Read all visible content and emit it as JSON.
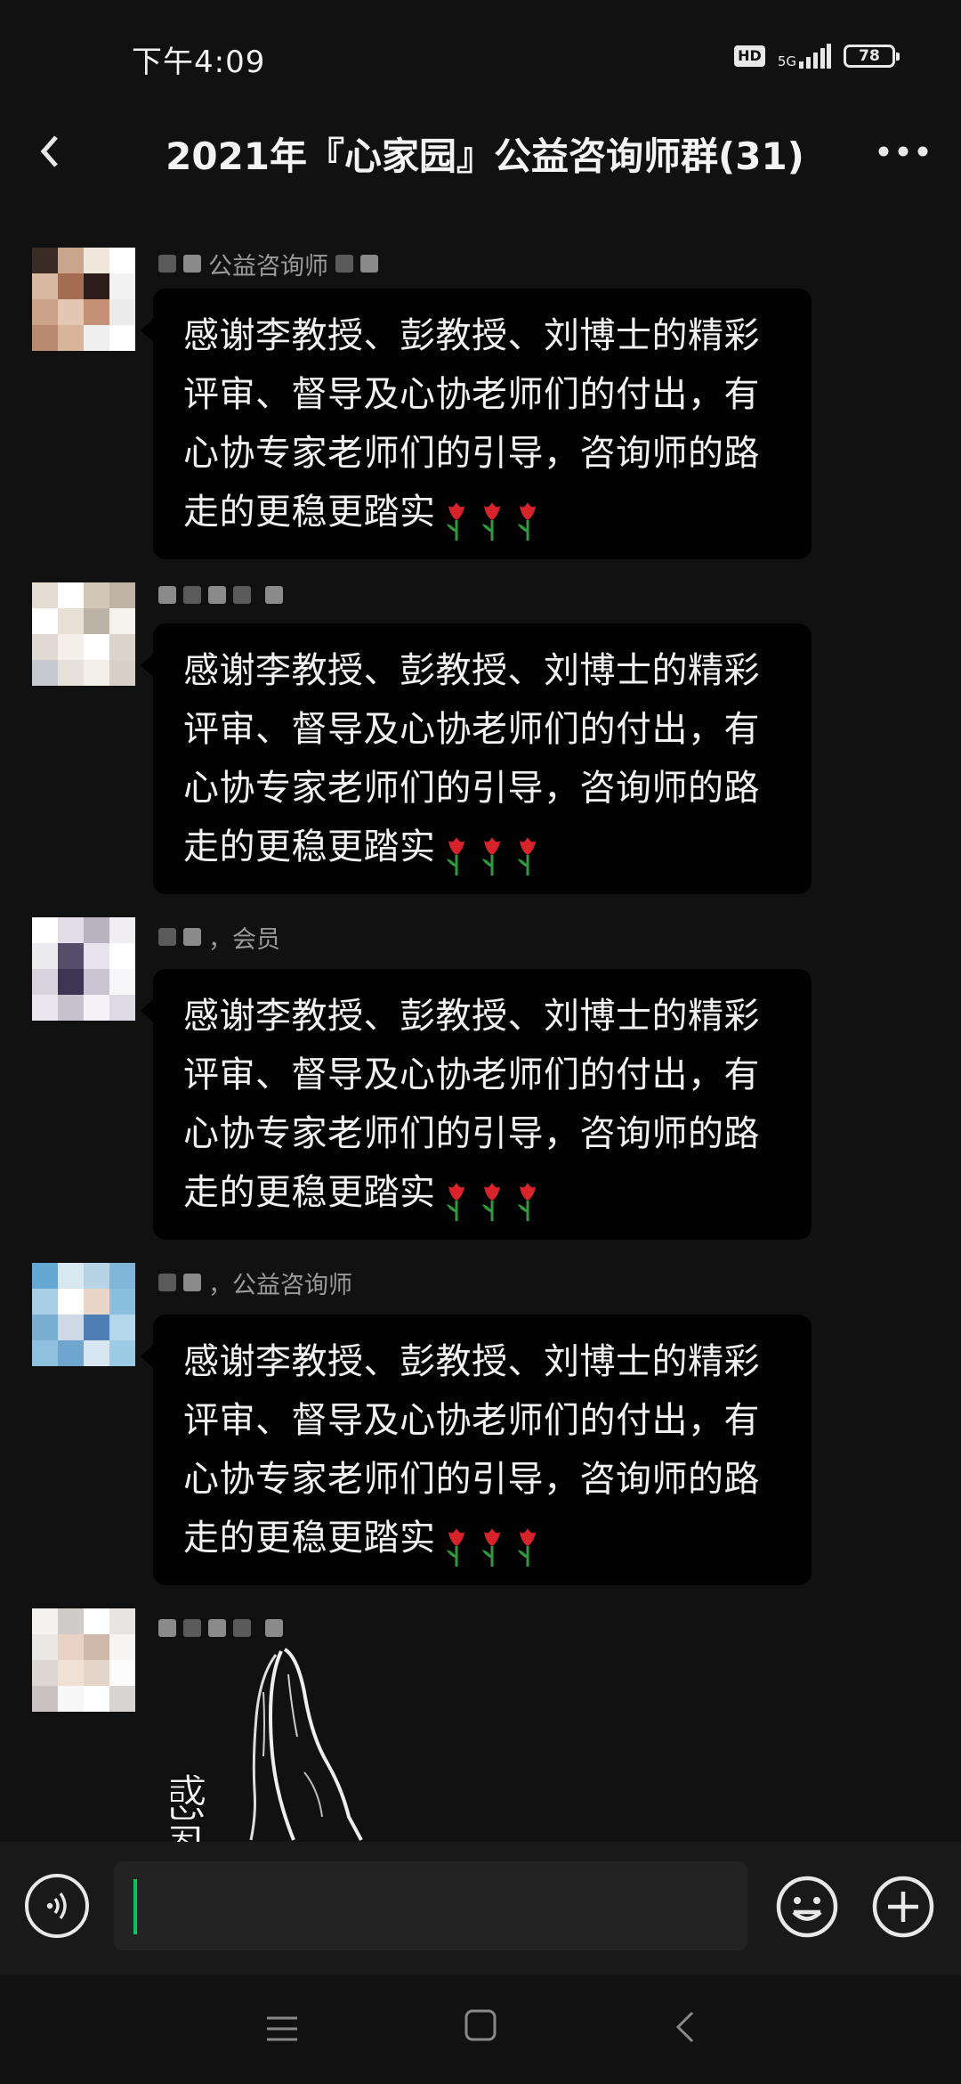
{
  "status_bar": {
    "time": "下午4:09",
    "hd": "HD",
    "network": "5G",
    "battery": "78"
  },
  "header": {
    "title": "2021年『心家园』公益咨询师群(31)",
    "back_icon": "chevron-left-icon",
    "more_icon": "more-dots-icon"
  },
  "messages": [
    {
      "sender": "公益咨询师",
      "text": "感谢李教授、彭教授、刘博士的精彩评审、督导及心协老师们的付出，有心协专家老师们的引导，咨询师的路走的更稳更踏实",
      "emoji": "tulip-icon"
    },
    {
      "sender": "",
      "text": "感谢李教授、彭教授、刘博士的精彩评审、督导及心协老师们的付出，有心协专家老师们的引导，咨询师的路走的更稳更踏实",
      "emoji": "tulip-icon"
    },
    {
      "sender": "，会员",
      "text": "感谢李教授、彭教授、刘博士的精彩评审、督导及心协老师们的付出，有心协专家老师们的引导，咨询师的路走的更稳更踏实",
      "emoji": "tulip-icon"
    },
    {
      "sender": "，公益咨询师",
      "text": "感谢李教授、彭教授、刘博士的精彩评审、督导及心协老师们的付出，有心协专家老师们的引导，咨询师的路走的更稳更踏实",
      "emoji": "tulip-icon"
    }
  ],
  "sticker_message": {
    "sender": "",
    "sticker": "praying-hands-sticker",
    "sticker_text": "感恩"
  },
  "input_bar": {
    "value": "",
    "placeholder": "",
    "voice_icon": "voice-icon",
    "emoji_icon": "smiley-icon",
    "plus_icon": "plus-icon"
  },
  "nav_bar": {
    "menu_icon": "menu-icon",
    "home_icon": "home-square-icon",
    "back_icon": "back-triangle-icon"
  },
  "colors": {
    "background": "#111111",
    "bubble": "#020202",
    "accent": "#07c160",
    "text": "#f1f1f1",
    "muted_text": "#9a9a9a"
  }
}
